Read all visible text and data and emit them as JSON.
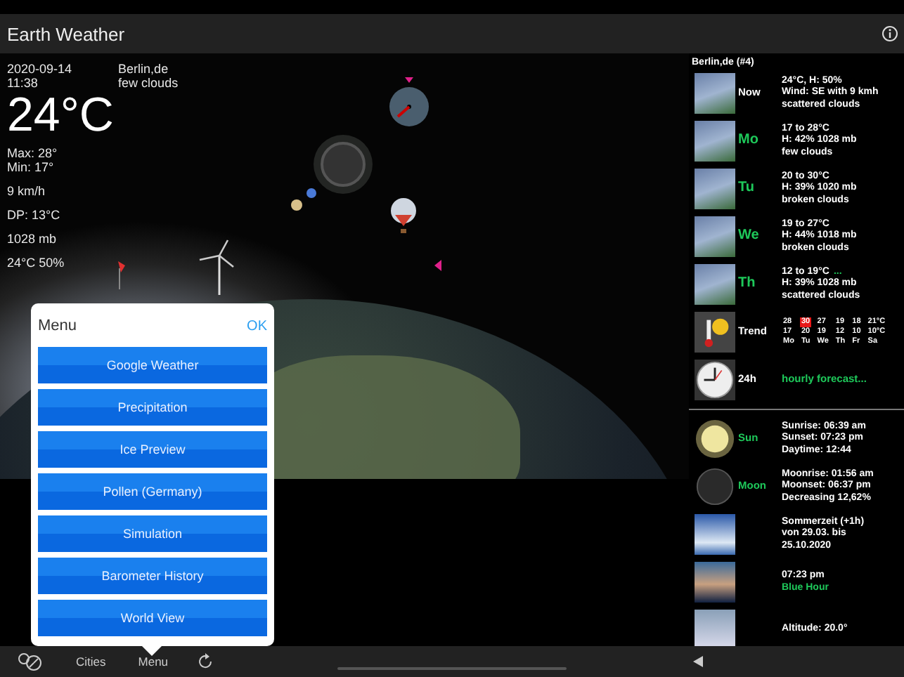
{
  "header": {
    "title": "Earth Weather"
  },
  "current": {
    "date": "2020-09-14",
    "time": "11:38",
    "location": "Berlin,de",
    "condition": "few clouds",
    "temperature": "24°C",
    "max": "Max: 28°",
    "min": "Min: 17°",
    "wind": "9 km/h",
    "dew_point": "DP: 13°C",
    "pressure": "1028 mb",
    "indoor": "24°C 50%"
  },
  "forecast": {
    "title": "Berlin,de (#4)",
    "rows": [
      {
        "kind": "now",
        "label": "Now",
        "lines": [
          "24°C, H: 50%",
          "Wind: SE with 9 kmh",
          "scattered clouds"
        ]
      },
      {
        "kind": "day",
        "label": "Mo",
        "lines": [
          "17 to 28°C",
          "H: 42% 1028 mb",
          "few clouds"
        ]
      },
      {
        "kind": "day",
        "label": "Tu",
        "lines": [
          "20 to 30°C",
          "H: 39% 1020 mb",
          "broken clouds"
        ]
      },
      {
        "kind": "day",
        "label": "We",
        "lines": [
          "19 to 27°C",
          "H: 44% 1018 mb",
          "broken clouds"
        ]
      },
      {
        "kind": "day",
        "label": "Th",
        "lines": [
          "12 to 19°C",
          "H: 39% 1028 mb",
          "scattered clouds"
        ],
        "more": "..."
      },
      {
        "kind": "trend",
        "label": "Trend",
        "columns": [
          {
            "high": "28",
            "low": "17",
            "day": "Mo",
            "highlighted": false
          },
          {
            "high": "30",
            "low": "20",
            "day": "Tu",
            "highlighted": true
          },
          {
            "high": "27",
            "low": "19",
            "day": "We",
            "highlighted": false
          },
          {
            "high": "19",
            "low": "12",
            "day": "Th",
            "highlighted": false
          },
          {
            "high": "18",
            "low": "10",
            "day": "Fr",
            "highlighted": false
          },
          {
            "high": "21°C",
            "low": "10°C",
            "day": "Sa",
            "highlighted": false
          }
        ]
      },
      {
        "kind": "hourly",
        "label": "24h",
        "link": "hourly forecast..."
      }
    ]
  },
  "almanac": [
    {
      "kind": "sun",
      "label": "Sun",
      "lines": [
        "Sunrise: 06:39 am",
        "Sunset: 07:23 pm",
        "Daytime: 12:44"
      ]
    },
    {
      "kind": "moon",
      "label": "Moon",
      "lines": [
        "Moonrise: 01:56 am",
        "Moonset: 06:37 pm",
        "Decreasing 12,62%"
      ]
    },
    {
      "kind": "dst",
      "lines": [
        "Sommerzeit (+1h)",
        "von 29.03. bis",
        "25.10.2020"
      ]
    },
    {
      "kind": "blue_hour",
      "lines": [
        "07:23 pm"
      ],
      "highlight": "Blue Hour"
    },
    {
      "kind": "iss",
      "lines": [
        "Altitude: 20.0°"
      ]
    }
  ],
  "menu": {
    "title": "Menu",
    "confirm": "OK",
    "items": [
      "Google Weather",
      "Precipitation",
      "Ice Preview",
      "Pollen (Germany)",
      "Simulation",
      "Barometer History",
      "World View"
    ]
  },
  "toolbar": {
    "cities": "Cities",
    "menu": "Menu"
  }
}
